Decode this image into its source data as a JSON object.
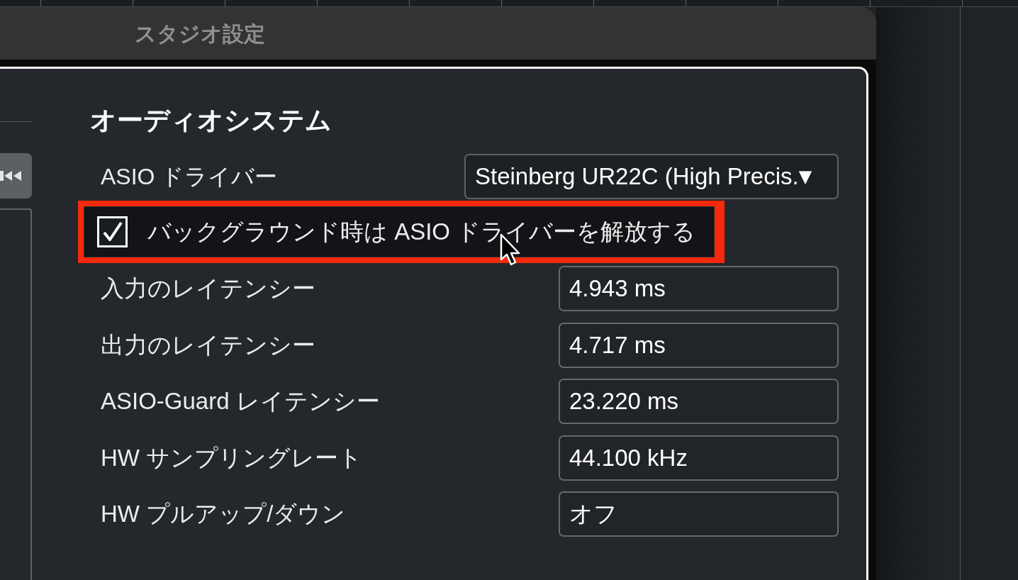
{
  "window": {
    "title": "スタジオ設定"
  },
  "section": {
    "title": "オーディオシステム"
  },
  "settings": [
    {
      "kind": "dropdown",
      "label": "ASIO ドライバー",
      "value": "Steinberg UR22C (High Precis.",
      "arrow": "▼"
    },
    {
      "kind": "checkbox",
      "label": "バックグラウンド時は ASIO ドライバーを解放する",
      "checked": true,
      "highlighted": true
    },
    {
      "kind": "readout",
      "label": "入力のレイテンシー",
      "value": "4.943 ms"
    },
    {
      "kind": "readout",
      "label": "出力のレイテンシー",
      "value": "4.717 ms"
    },
    {
      "kind": "readout",
      "label": "ASIO-Guard レイテンシー",
      "value": "23.220 ms"
    },
    {
      "kind": "readout",
      "label": "HW サンプリングレート",
      "value": "44.100 kHz"
    },
    {
      "kind": "readout",
      "label": "HW プルアップ/ダウン",
      "value": "オフ"
    }
  ]
}
